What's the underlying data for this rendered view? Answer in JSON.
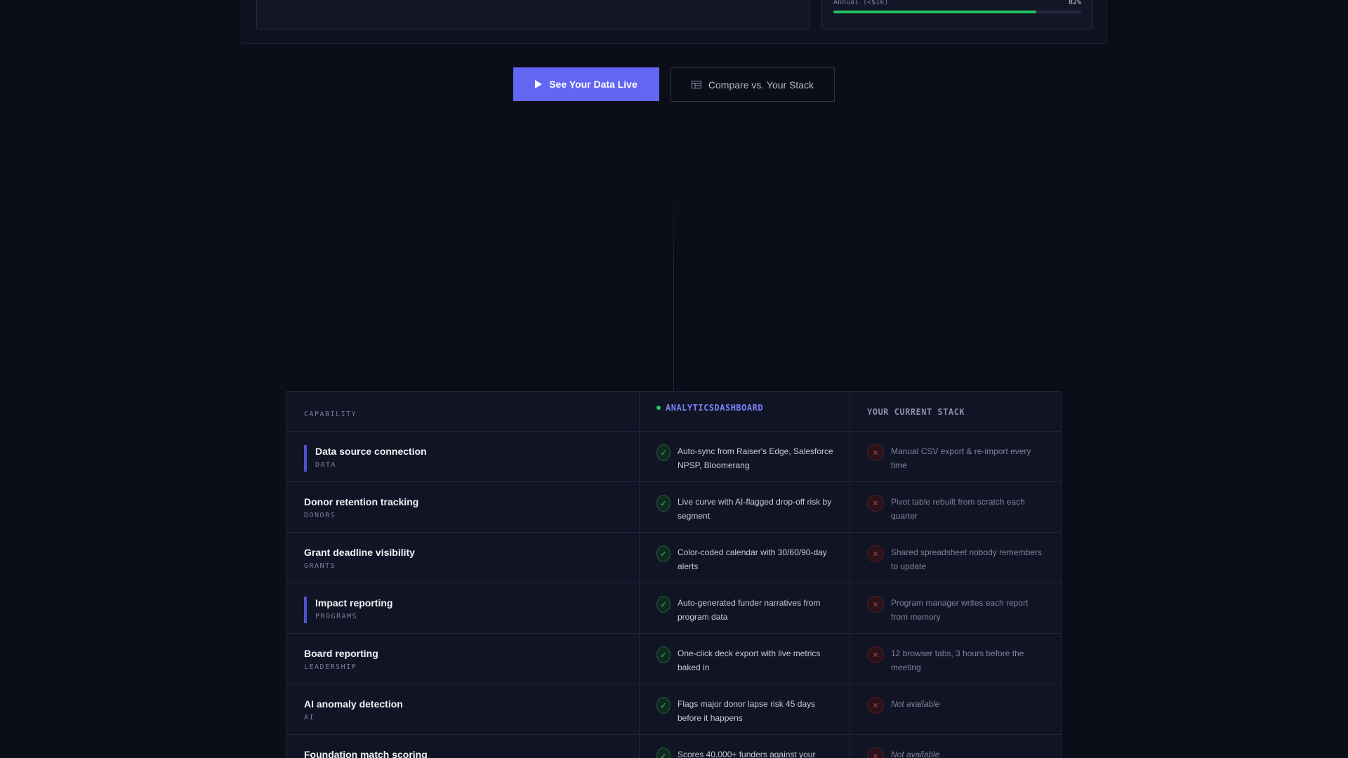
{
  "top_meter": {
    "label": "Annual (<$1k)",
    "value_text": "82%",
    "value": 0.82,
    "color": "#22c55e"
  },
  "cta": {
    "primary_label": "See Your Data Live",
    "primary_icon": "play-icon",
    "secondary_label": "Compare vs. Your Stack",
    "secondary_icon": "table-icon",
    "accent_color": "#6366f1"
  },
  "comparison": {
    "headers": {
      "capability": "CAPABILITY",
      "product": "ANALYTICSDASHBOARD",
      "stack": "YOUR CURRENT STACK"
    },
    "rows": [
      {
        "title": "Data source connection",
        "tag": "DATA",
        "accent": true,
        "product": "Auto-sync from Raiser's Edge, Salesforce NPSP, Bloomerang",
        "stack": "Manual CSV export & re-import every time",
        "stack_na": false
      },
      {
        "title": "Donor retention tracking",
        "tag": "DONORS",
        "accent": false,
        "product": "Live curve with AI-flagged drop-off risk by segment",
        "stack": "Pivot table rebuilt from scratch each quarter",
        "stack_na": false
      },
      {
        "title": "Grant deadline visibility",
        "tag": "GRANTS",
        "accent": false,
        "product": "Color-coded calendar with 30/60/90-day alerts",
        "stack": "Shared spreadsheet nobody remembers to update",
        "stack_na": false
      },
      {
        "title": "Impact reporting",
        "tag": "PROGRAMS",
        "accent": true,
        "product": "Auto-generated funder narratives from program data",
        "stack": "Program manager writes each report from memory",
        "stack_na": false
      },
      {
        "title": "Board reporting",
        "tag": "LEADERSHIP",
        "accent": false,
        "product": "One-click deck export with live metrics baked in",
        "stack": "12 browser tabs, 3 hours before the meeting",
        "stack_na": false
      },
      {
        "title": "AI anomaly detection",
        "tag": "AI",
        "accent": false,
        "product": "Flags major donor lapse risk 45 days before it happens",
        "stack": "Not available",
        "stack_na": true
      },
      {
        "title": "Foundation match scoring",
        "tag": "",
        "accent": false,
        "product": "Scores 40,000+ funders against your",
        "stack": "Not available",
        "stack_na": true
      }
    ]
  }
}
